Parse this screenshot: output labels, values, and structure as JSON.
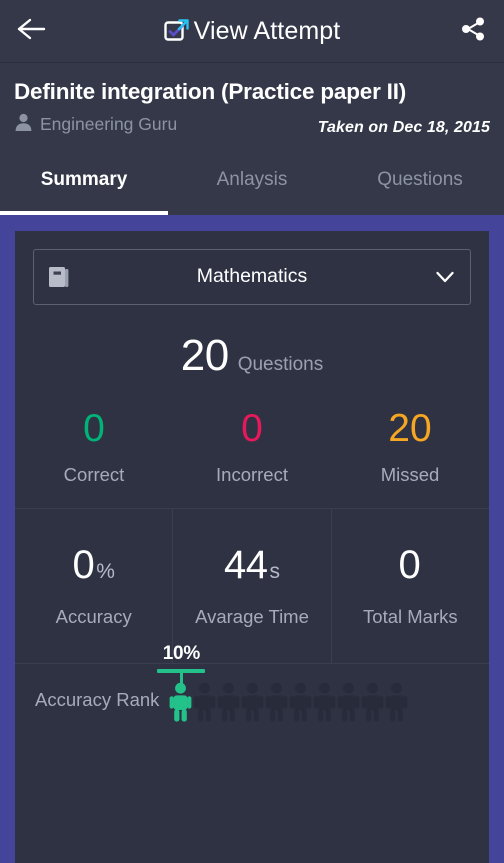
{
  "topbar": {
    "back_icon": "arrow-left-icon",
    "logo_icon": "app-logo-icon",
    "title": "View Attempt",
    "share_icon": "share-icon"
  },
  "header": {
    "paper_title": "Definite integration (Practice paper II)",
    "author_icon": "person-icon",
    "author": "Engineering Guru",
    "taken_on": "Taken on Dec 18, 2015"
  },
  "tabs": [
    {
      "label": "Summary",
      "active": true
    },
    {
      "label": "Anlaysis",
      "active": false
    },
    {
      "label": "Questions",
      "active": false
    }
  ],
  "summary": {
    "subject_select": {
      "icon": "book-icon",
      "value": "Mathematics",
      "chevron_icon": "chevron-down-icon"
    },
    "question_count": {
      "value": "20",
      "label": "Questions"
    },
    "tri_stats": [
      {
        "value": "0",
        "label": "Correct",
        "color": "#00b377"
      },
      {
        "value": "0",
        "label": "Incorrect",
        "color": "#e8195b"
      },
      {
        "value": "20",
        "label": "Missed",
        "color": "#f5a623"
      }
    ],
    "grid_stats": [
      {
        "value": "0",
        "unit": "%",
        "label": "Accuracy"
      },
      {
        "value": "44",
        "unit": "s",
        "label": "Avarage Time"
      },
      {
        "value": "0",
        "unit": "",
        "label": "Total Marks"
      }
    ],
    "accuracy_rank": {
      "label": "Accuracy Rank",
      "percent": "10%",
      "figure_count": 10,
      "highlight_index": 0,
      "highlight_color": "#24c28b",
      "figure_color": "#272b3a"
    }
  },
  "colors": {
    "page_background": "#45449b",
    "bar_background": "#343848",
    "card_background": "#2f3243",
    "accent_cyan": "#29c2f0",
    "accent_purple": "#5b4ec7"
  }
}
